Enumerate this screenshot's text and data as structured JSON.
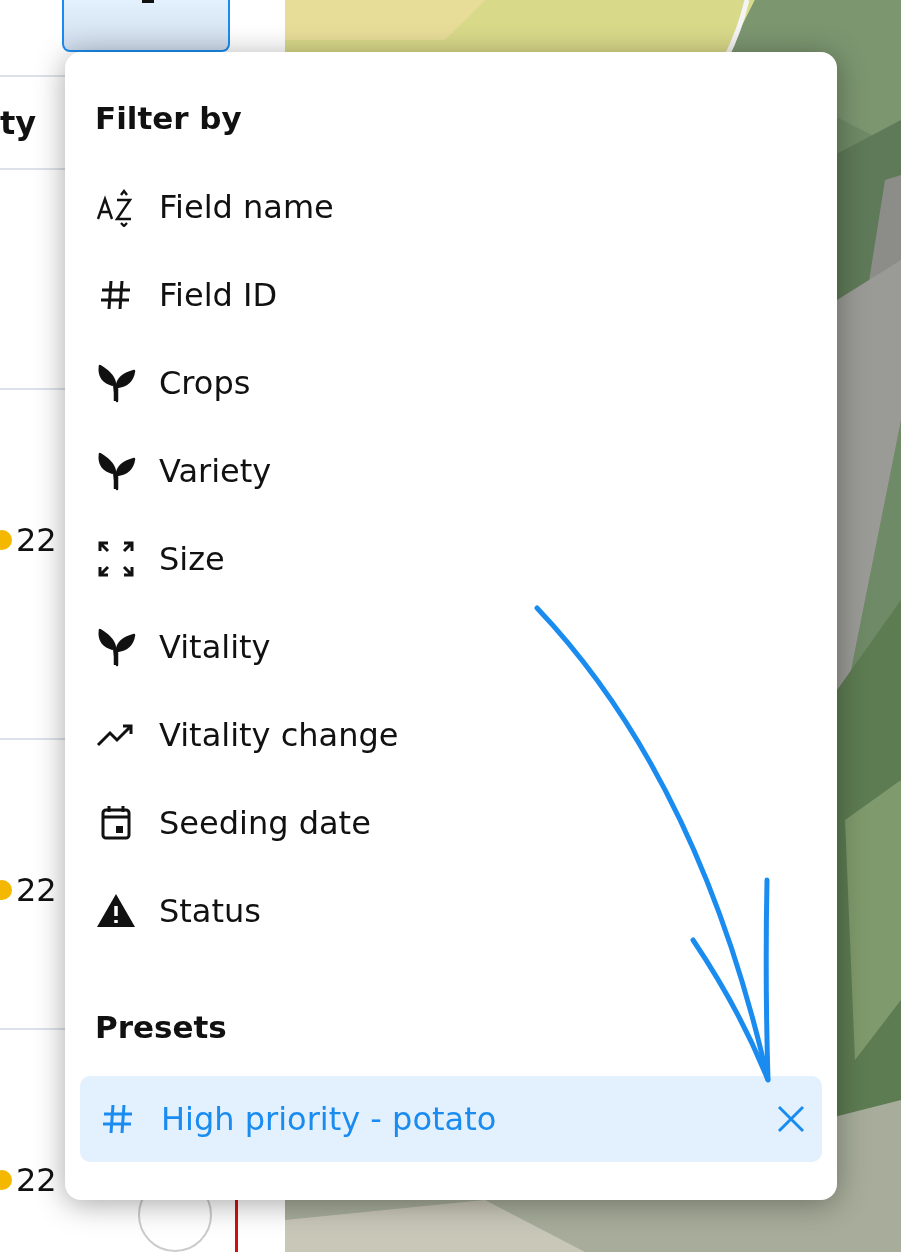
{
  "left_panel": {
    "column_header": "ty",
    "rows": [
      {
        "value": "22"
      },
      {
        "value": "22"
      },
      {
        "value": "22"
      }
    ]
  },
  "filter_menu": {
    "title": "Filter by",
    "items": [
      {
        "kind": "az",
        "label": "Field name"
      },
      {
        "kind": "hash",
        "label": "Field ID"
      },
      {
        "kind": "sprout",
        "label": "Crops"
      },
      {
        "kind": "sprout",
        "label": "Variety"
      },
      {
        "kind": "expand",
        "label": "Size"
      },
      {
        "kind": "sprout",
        "label": "Vitality"
      },
      {
        "kind": "trend",
        "label": "Vitality change"
      },
      {
        "kind": "calendar",
        "label": "Seeding date"
      },
      {
        "kind": "warning",
        "label": "Status"
      }
    ],
    "presets_title": "Presets",
    "presets": [
      {
        "label": "High priority - potato",
        "selected": true
      }
    ]
  }
}
